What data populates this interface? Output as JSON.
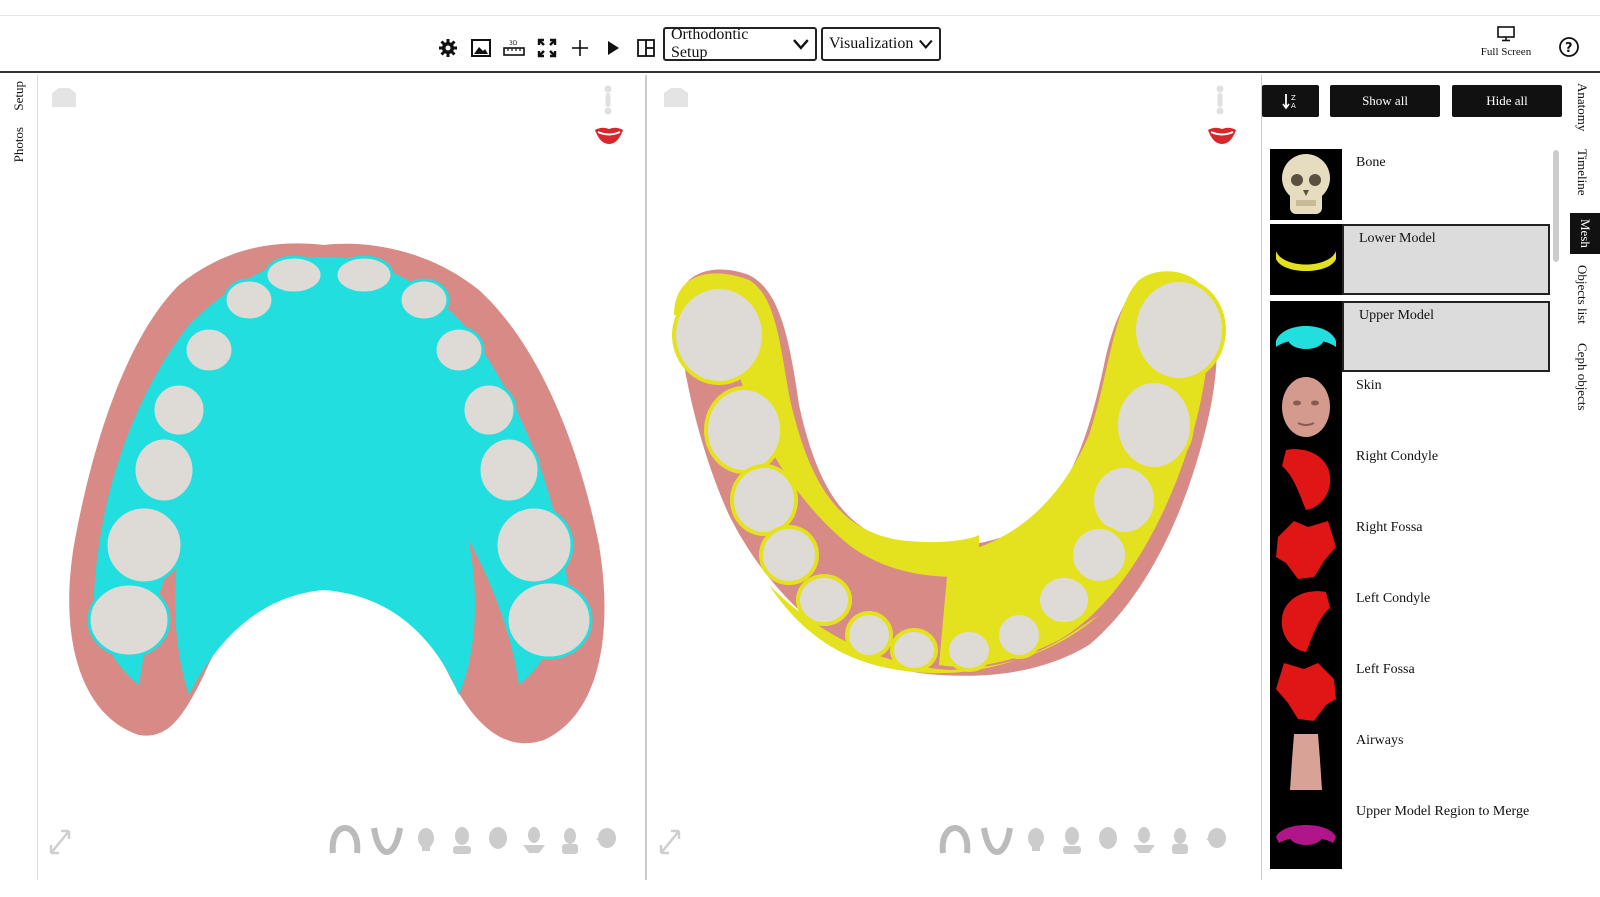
{
  "toolbar": {
    "icons": [
      "settings-gear-icon",
      "image-icon",
      "ruler-3d-icon",
      "expand-icon",
      "plus-icon",
      "play-icon",
      "split-layout-icon"
    ],
    "dropdown_setup": "Orthodontic Setup",
    "dropdown_visualization": "Visualization",
    "fullscreen_label": "Full Screen"
  },
  "left_tabs": [
    "Setup",
    "Photos"
  ],
  "right_tabs": [
    "Anatomy",
    "Timeline",
    "Mesh",
    "Objects list",
    "Ceph objects"
  ],
  "active_right_tab": "Mesh",
  "panel": {
    "show_all": "Show all",
    "hide_all": "Hide all",
    "items": [
      {
        "label": "Bone",
        "thumb": "skull",
        "selected": false
      },
      {
        "label": "Lower Model",
        "thumb": "lower-arch-yellow",
        "selected": true
      },
      {
        "label": "Upper Model",
        "thumb": "upper-arch-cyan",
        "selected": true
      },
      {
        "label": "Skin",
        "thumb": "face",
        "selected": false
      },
      {
        "label": "Right Condyle",
        "thumb": "red-condyle",
        "selected": false
      },
      {
        "label": "Right Fossa",
        "thumb": "red-fossa",
        "selected": false
      },
      {
        "label": "Left Condyle",
        "thumb": "red-condyle",
        "selected": false
      },
      {
        "label": "Left Fossa",
        "thumb": "red-fossa",
        "selected": false
      },
      {
        "label": "Airways",
        "thumb": "airway",
        "selected": false
      },
      {
        "label": "Upper Model Region to Merge",
        "thumb": "magenta-arch",
        "selected": false
      }
    ]
  },
  "colors": {
    "cyan": "#22dede",
    "yellow": "#e4e21e",
    "gum": "#d88a86",
    "tooth": "#dedbd6",
    "red": "#d8262a"
  }
}
